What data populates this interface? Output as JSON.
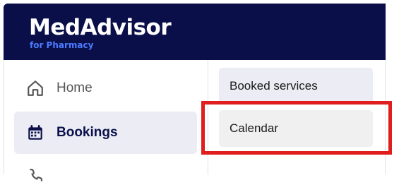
{
  "brand": {
    "name": "MedAdvisor",
    "subtitle": "for Pharmacy"
  },
  "nav": {
    "home": {
      "label": "Home",
      "icon": "home-icon"
    },
    "bookings": {
      "label": "Bookings",
      "icon": "calendar-icon"
    },
    "partial_icon": "phone-icon"
  },
  "submenu": {
    "booked_services": "Booked services",
    "calendar": "Calendar"
  },
  "colors": {
    "header_bg": "#0a0f4a",
    "brand_accent": "#4b7bff",
    "active_bg": "#ececf4",
    "highlight": "#e01e1e"
  }
}
